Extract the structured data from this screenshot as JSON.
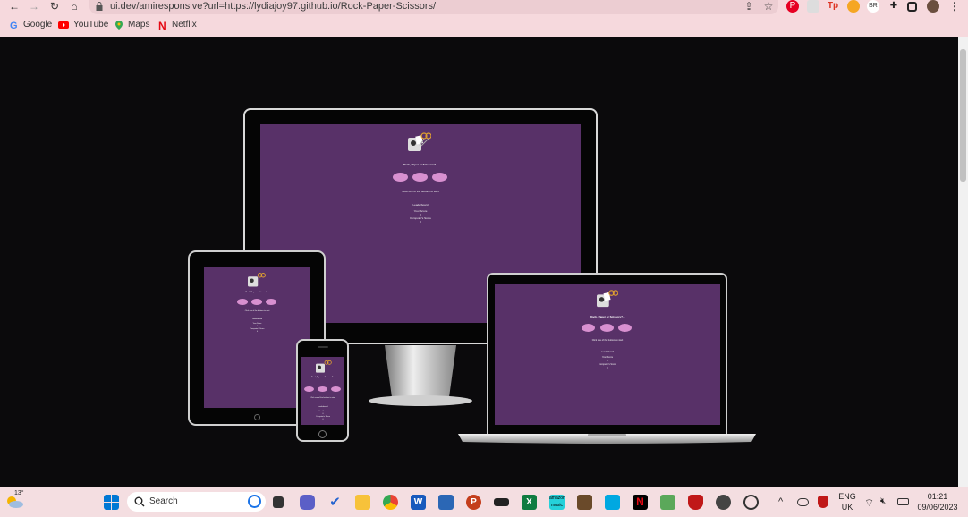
{
  "browser": {
    "url": "ui.dev/amiresponsive?url=https://lydiajoy97.github.io/Rock-Paper-Scissors/",
    "profile_badge": "BR",
    "bookmarks": [
      {
        "label": "Google",
        "icon": "google-icon"
      },
      {
        "label": "YouTube",
        "icon": "youtube-icon"
      },
      {
        "label": "Maps",
        "icon": "maps-icon"
      },
      {
        "label": "Netflix",
        "icon": "netflix-icon"
      }
    ]
  },
  "mockup": {
    "app_heading": "Rock, Paper or Scissors?...",
    "instruction": "Click one of the buttons to start",
    "leaderboard": "Leaderboard",
    "your_score": "Your Score",
    "computer_score": "Computer's Score",
    "score_value": "0",
    "screen_color": "#583168",
    "button_color": "#d890d0"
  },
  "taskbar": {
    "weather_temp": "13°",
    "search_placeholder": "Search",
    "language_line1": "ENG",
    "language_line2": "UK",
    "time": "01:21",
    "date": "09/06/2023"
  }
}
